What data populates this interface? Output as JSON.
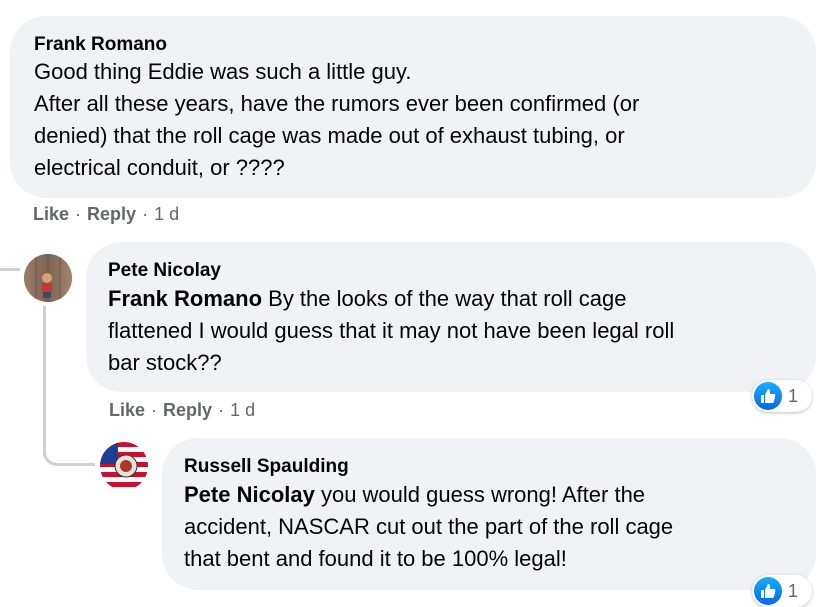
{
  "comments": [
    {
      "author": "Frank Romano",
      "text_lines": [
        "Good thing Eddie was such a little guy.",
        "After all these years, have the rumors ever been confirmed (or",
        "denied) that the roll cage was made out of exhaust tubing, or",
        "electrical conduit, or ????"
      ],
      "actions": {
        "like": "Like",
        "reply": "Reply",
        "time": "1 d"
      }
    },
    {
      "author": "Pete Nicolay",
      "mention": "Frank Romano",
      "text_lines": [
        " By the looks of the way that roll cage",
        "flattened I would guess that it may not have been legal roll",
        "bar stock??"
      ],
      "actions": {
        "like": "Like",
        "reply": "Reply",
        "time": "1 d"
      },
      "reaction_count": "1"
    },
    {
      "author": "Russell Spaulding",
      "mention": "Pete Nicolay",
      "text_lines": [
        " you would guess wrong! After the",
        "accident, NASCAR cut out the part of the roll cage",
        "that bent and found it to be 100% legal!"
      ],
      "reaction_count": "1"
    }
  ],
  "separator": "·",
  "icons": {
    "reaction": "like-thumb-icon",
    "avatar_pete": "avatar",
    "avatar_russell": "flag-avatar"
  },
  "colors": {
    "bubble": "#f0f2f5",
    "meta": "#65676b",
    "like_blue": "#1877f2",
    "thread_line": "#ced0d4"
  }
}
